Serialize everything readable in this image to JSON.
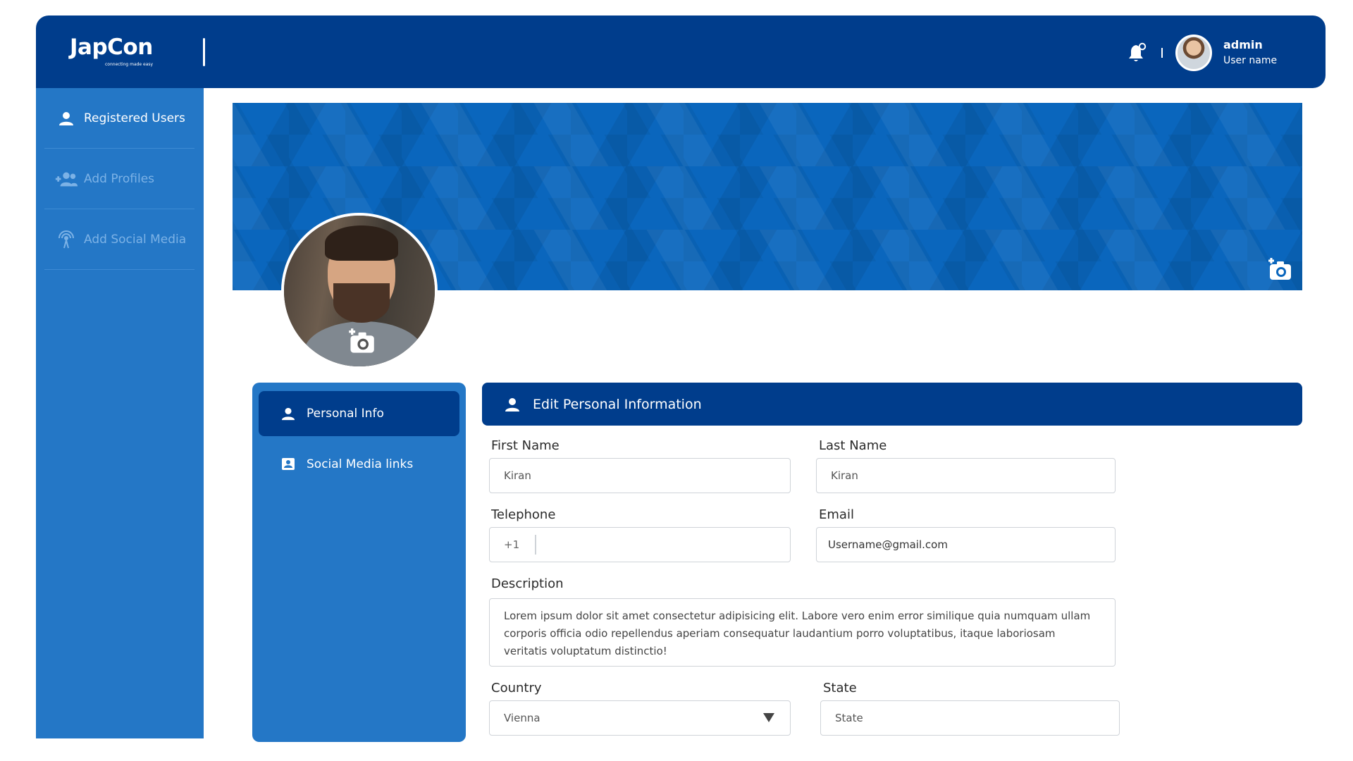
{
  "header": {
    "logo_text": "JapCon",
    "logo_tagline": "connecting made easy",
    "user": {
      "name": "admin",
      "role_label": "User name"
    }
  },
  "sidebar": {
    "items": [
      {
        "label": "Registered Users",
        "icon": "user-icon",
        "active": true
      },
      {
        "label": "Add Profiles",
        "icon": "add-users-icon",
        "active": false
      },
      {
        "label": "Add Social Media",
        "icon": "broadcast-icon",
        "active": false
      }
    ]
  },
  "profile_tabs": [
    {
      "label": "Personal Info",
      "icon": "user-icon",
      "active": true
    },
    {
      "label": "Social Media links",
      "icon": "contact-card-icon",
      "active": false
    }
  ],
  "form": {
    "title": "Edit Personal Information",
    "first_name": {
      "label": "First Name",
      "value": "Kiran"
    },
    "last_name": {
      "label": "Last Name",
      "value": "Kiran"
    },
    "telephone": {
      "label": "Telephone",
      "prefix": "+1",
      "value": ""
    },
    "email": {
      "label": "Email",
      "value": "Username@gmail.com"
    },
    "description": {
      "label": "Description",
      "value": "Lorem ipsum dolor sit amet consectetur adipisicing elit. Labore vero enim error similique quia numquam ullam corporis officia odio repellendus aperiam consequatur laudantium porro voluptatibus, itaque laboriosam veritatis voluptatum distinctio!"
    },
    "country": {
      "label": "Country",
      "value": "Vienna"
    },
    "state": {
      "label": "State",
      "placeholder": "State"
    }
  },
  "colors": {
    "header_bg": "#003d8c",
    "sidebar_bg": "#2477c6",
    "cover_bg": "#0a66bd",
    "sidebar_dim_text": "#7cb2e6"
  }
}
